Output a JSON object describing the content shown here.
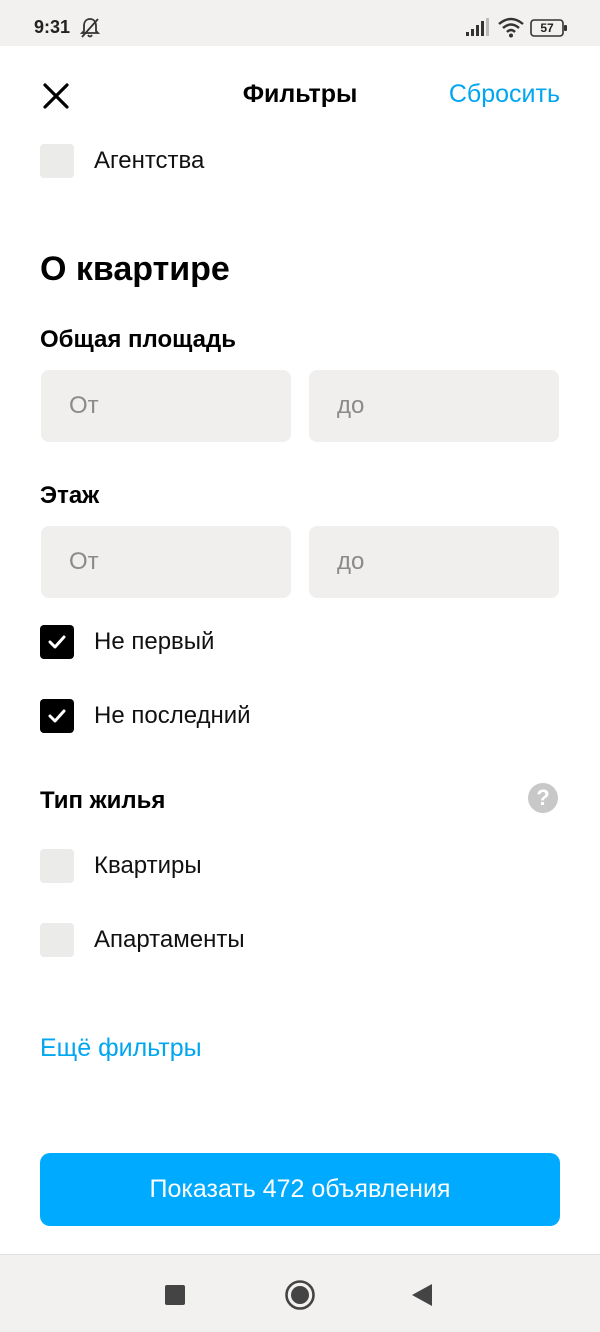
{
  "status_bar": {
    "time": "9:31",
    "battery": "57"
  },
  "header": {
    "title": "Фильтры",
    "reset_label": "Сбросить"
  },
  "agencies": {
    "label": "Агентства",
    "checked": false
  },
  "apartment_section": {
    "title": "О квартире"
  },
  "total_area": {
    "label": "Общая площадь",
    "from_placeholder": "От",
    "to_placeholder": "до"
  },
  "floor": {
    "label": "Этаж",
    "from_placeholder": "От",
    "to_placeholder": "до",
    "not_first": {
      "label": "Не первый",
      "checked": true
    },
    "not_last": {
      "label": "Не последний",
      "checked": true
    }
  },
  "housing_type": {
    "label": "Тип жилья",
    "help_glyph": "?",
    "options": [
      {
        "label": "Квартиры",
        "checked": false
      },
      {
        "label": "Апартаменты",
        "checked": false
      }
    ]
  },
  "more_filters_label": "Ещё фильтры",
  "show_button_label": "Показать 472 объявления",
  "colors": {
    "accent": "#00a6f0",
    "button": "#00aaff",
    "input_bg": "#f0efee",
    "checkbox_bg": "#ebebea"
  }
}
